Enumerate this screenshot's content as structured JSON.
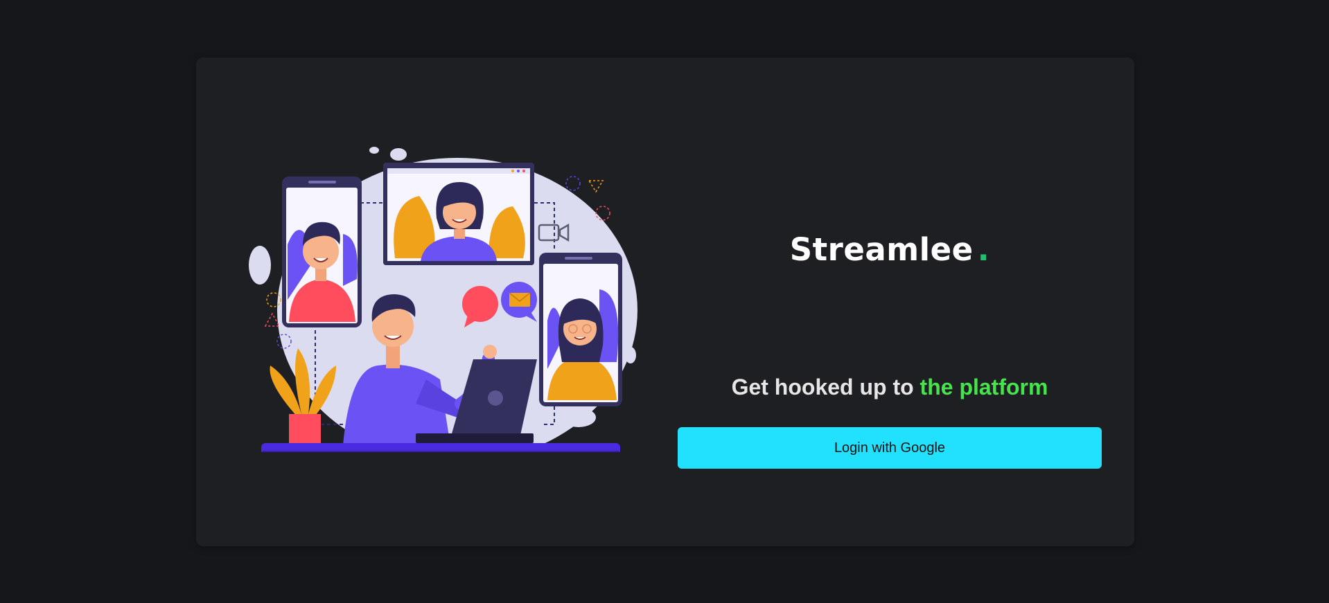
{
  "brand": {
    "name": "Streamlee",
    "dot": ".",
    "dot_color": "#1fc26b"
  },
  "tagline": {
    "prefix": "Get hooked up to ",
    "highlight": "the platform",
    "highlight_color": "#47e34d"
  },
  "login": {
    "label": "Login with Google",
    "background": "#22e1fe"
  },
  "illustration": {
    "icon": "video-call-illustration"
  },
  "colors": {
    "page_bg": "#16171b",
    "card_bg": "#1e1f23"
  }
}
